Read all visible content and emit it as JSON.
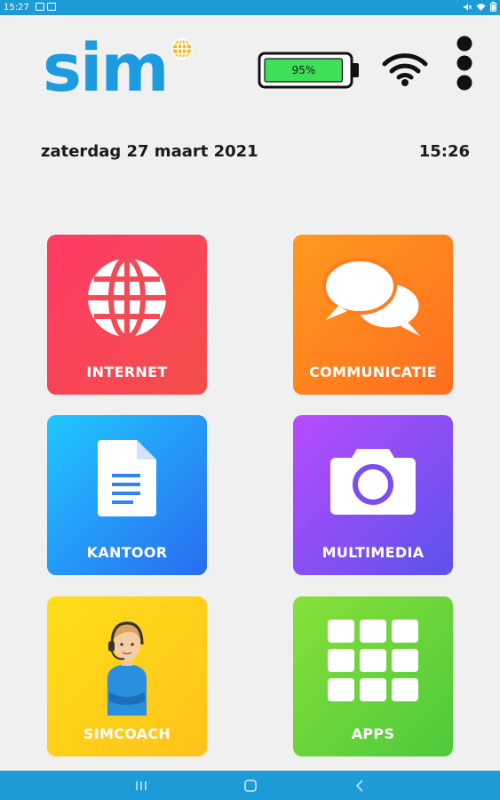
{
  "status_bar": {
    "time": "15:27",
    "icons": [
      "image-icon",
      "notification-icon",
      "mute-icon",
      "wifi-icon",
      "battery-icon"
    ]
  },
  "header": {
    "logo_text": "sim",
    "battery_percent": "95%",
    "battery_level": 0.95,
    "icons": [
      "globe-icon",
      "battery-icon",
      "wifi-icon",
      "more-vertical-icon"
    ]
  },
  "info": {
    "date": "zaterdag 27 maart 2021",
    "time": "15:26"
  },
  "tiles": [
    {
      "label": "INTERNET",
      "icon": "globe-icon",
      "color": "#f5435a"
    },
    {
      "label": "COMMUNICATIE",
      "icon": "chat-bubbles-icon",
      "color": "#ff8a1f"
    },
    {
      "label": "KANTOOR",
      "icon": "document-icon",
      "color": "#2a8ef5"
    },
    {
      "label": "MULTIMEDIA",
      "icon": "camera-icon",
      "color": "#8a4ef5"
    },
    {
      "label": "SIMCOACH",
      "icon": "coach-avatar-icon",
      "color": "#ffd21a"
    },
    {
      "label": "APPS",
      "icon": "apps-grid-icon",
      "color": "#66d43a"
    }
  ],
  "colors": {
    "accent": "#1c9bd6",
    "battery_fill": "#3ee058",
    "background": "#f0f0f0"
  },
  "navigation": {
    "icons": [
      "recent-apps-icon",
      "home-icon",
      "back-icon"
    ]
  }
}
